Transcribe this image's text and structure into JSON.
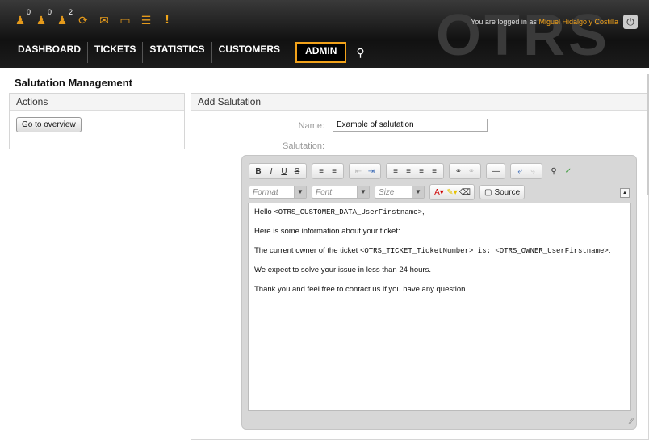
{
  "header": {
    "icons": [
      {
        "name": "locked-tickets-icon",
        "glyph": "♟",
        "count": "0"
      },
      {
        "name": "watched-tickets-icon",
        "glyph": "♟",
        "count": "0"
      },
      {
        "name": "responsible-tickets-icon",
        "glyph": "♟",
        "count": "2"
      },
      {
        "name": "refresh-icon",
        "glyph": "⟳",
        "count": ""
      },
      {
        "name": "mail-icon",
        "glyph": "✉",
        "count": ""
      },
      {
        "name": "folder-icon",
        "glyph": "▬",
        "count": ""
      },
      {
        "name": "list-icon",
        "glyph": "☰",
        "count": ""
      },
      {
        "name": "alert-icon",
        "glyph": "!",
        "count": ""
      }
    ],
    "login_prefix": "You are logged in as",
    "user_name": "Miguel Hidalgo y Costilla",
    "logo_text": "OTRS"
  },
  "nav": {
    "items": [
      "DASHBOARD",
      "TICKETS",
      "STATISTICS",
      "CUSTOMERS"
    ],
    "active": "ADMIN"
  },
  "page": {
    "title": "Salutation Management"
  },
  "actions": {
    "header": "Actions",
    "button": "Go to overview"
  },
  "form": {
    "header": "Add Salutation",
    "name_label": "Name:",
    "name_value": "Example of salutation",
    "salutation_label": "Salutation:"
  },
  "editor": {
    "format_label": "Format",
    "font_label": "Font",
    "size_label": "Size",
    "source_label": "Source",
    "lines": [
      {
        "text": "Hello ",
        "code": "<OTRS_CUSTOMER_DATA_UserFirstname>",
        "after": ","
      },
      {
        "text": "Here is some information about your ticket:",
        "code": "",
        "after": ""
      },
      {
        "text": "The current owner of the ticket ",
        "code": "<OTRS_TICKET_TicketNumber> is: <OTRS_OWNER_UserFirstname>",
        "after": "."
      },
      {
        "text": "We expect to solve your issue in less than 24 hours.",
        "code": "",
        "after": ""
      },
      {
        "text": "Thank you and feel free to contact us if you have any question.",
        "code": "",
        "after": ""
      }
    ]
  },
  "colors": {
    "accent": "#f2a21a",
    "header_bg": "#1c1c1c"
  }
}
